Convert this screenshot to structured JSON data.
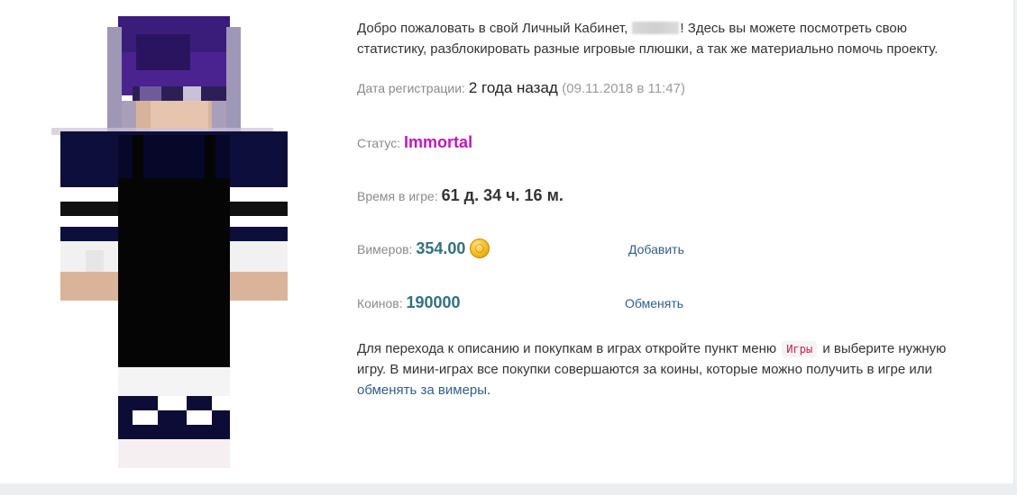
{
  "welcome": {
    "prefix": "Добро пожаловать в свой Личный Кабинет, ",
    "suffix": "! Здесь вы можете посмотреть свою статистику, разблокировать разные игровые плюшки, а так же материально помочь проекту."
  },
  "registration": {
    "label": "Дата регистрации: ",
    "relative": "2 года назад",
    "exact": "(09.11.2018 в 11:47)"
  },
  "status": {
    "label": "Статус: ",
    "value": "Immortal",
    "color": "#c018b8"
  },
  "playtime": {
    "label": "Время в игре: ",
    "value": "61 д. 34 ч. 16 м."
  },
  "vimers": {
    "label": "Вимеров: ",
    "value": "354.00",
    "icon": "gold-coin-icon",
    "action": "Добавить"
  },
  "coins": {
    "label": "Коинов: ",
    "value": "190000",
    "action": "Обменять"
  },
  "note": {
    "part1": "Для перехода к описанию и покупкам в играх откройте пункт меню ",
    "menu_tag": "Игры",
    "part2": " и выберите нужную игру. В мини-играх все покупки совершаются за коины, которые можно получить в игре или ",
    "link": "обменять за вимеры",
    "part3": "."
  },
  "colors": {
    "accent_link": "#2f5f8a",
    "value_teal": "#33707f",
    "label_gray": "#8a8a8a"
  }
}
